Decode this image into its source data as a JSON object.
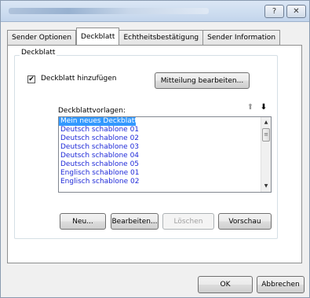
{
  "window": {
    "help_glyph": "?",
    "close_glyph": "✕"
  },
  "tabs": [
    {
      "label": "Sender Optionen"
    },
    {
      "label": "Deckblatt"
    },
    {
      "label": "Echtheitsbestätigung"
    },
    {
      "label": "Sender Information"
    }
  ],
  "group": {
    "legend": "Deckblatt",
    "checkbox_label": "Deckblatt hinzufügen",
    "checkbox_checked": true,
    "checkbox_glyph": "✔",
    "edit_message_button": "Mitteilung bearbeiten...",
    "templates_label": "Deckblattvorlagen:",
    "sort_up_glyph": "⬆",
    "sort_down_glyph": "⬇",
    "templates": [
      "Mein neues Deckblatt",
      "Deutsch schablone 01",
      "Deutsch schablone 02",
      "Deutsch schablone 03",
      "Deutsch schablone 04",
      "Deutsch schablone 05",
      "Englisch schablone 01",
      "Englisch schablone 02"
    ],
    "selected_index": 0,
    "scroll_up_glyph": "▲",
    "scroll_down_glyph": "▼",
    "scroll_thumb_glyph": "≡",
    "buttons": {
      "new": "Neu...",
      "edit": "Bearbeiten...",
      "delete": "Löschen",
      "preview": "Vorschau"
    }
  },
  "footer": {
    "ok": "OK",
    "cancel": "Abbrechen"
  }
}
